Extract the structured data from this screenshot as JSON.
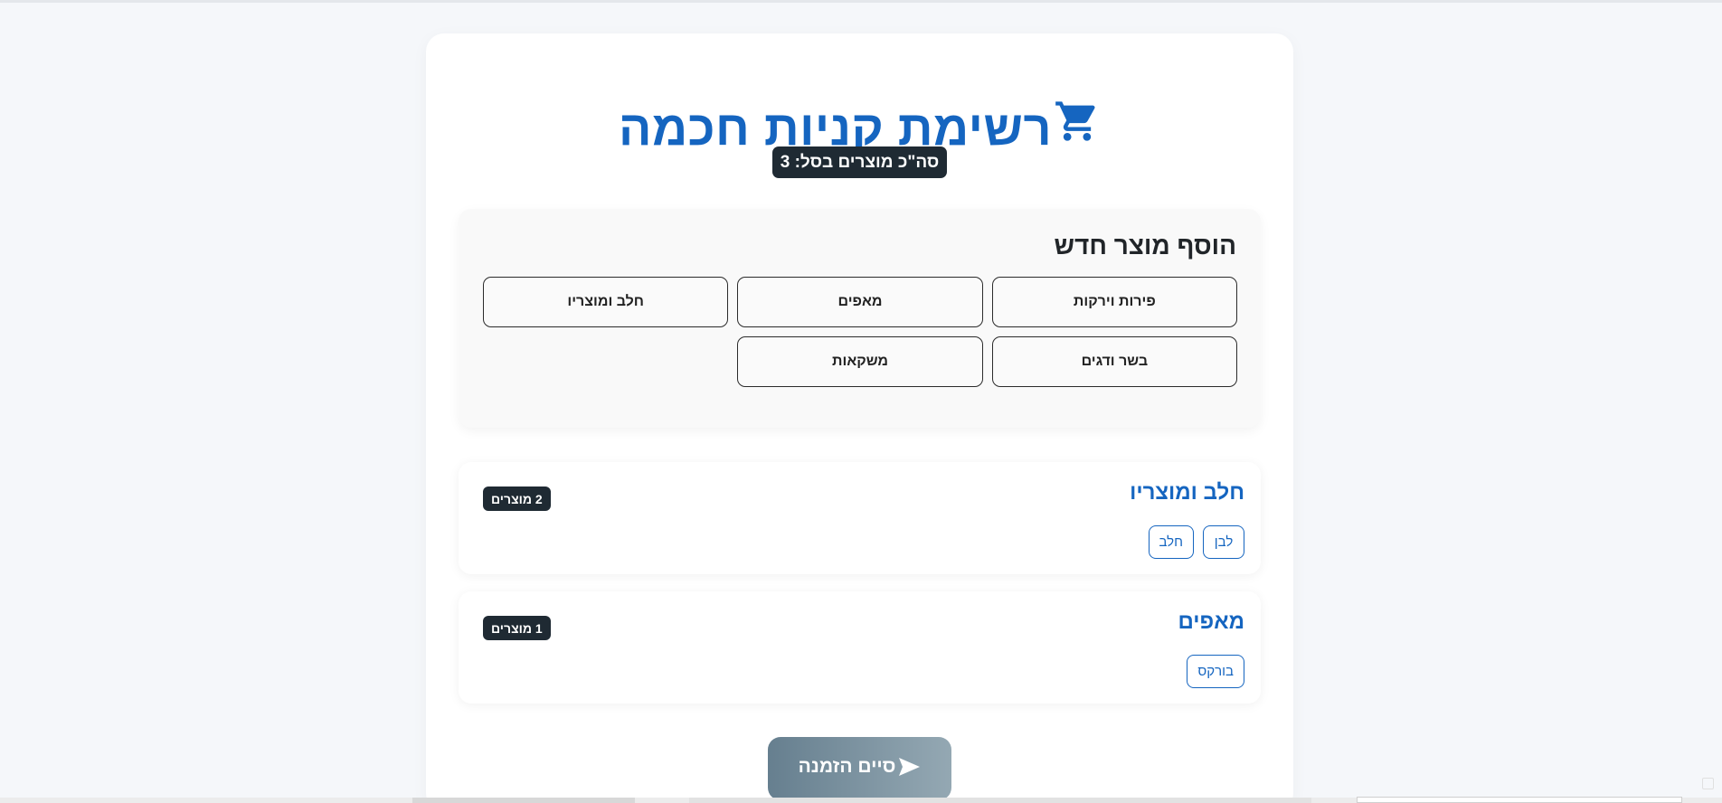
{
  "app": {
    "title": "רשימת קניות חכמה",
    "title_icon": "shopping-cart-icon",
    "total_label": "סה\"כ מוצרים בסל: 3"
  },
  "add_product": {
    "heading": "הוסף מוצר חדש",
    "categories": [
      {
        "label": "פירות וירקות"
      },
      {
        "label": "מאפים"
      },
      {
        "label": "חלב ומוצריו"
      },
      {
        "label": "בשר ודגים"
      },
      {
        "label": "משקאות"
      }
    ]
  },
  "cart_sections": [
    {
      "title": "חלב ומוצריו",
      "count_label": "2 מוצרים",
      "items": [
        "לבן",
        "חלב"
      ]
    },
    {
      "title": "מאפים",
      "count_label": "1 מוצרים",
      "items": [
        "בורקס"
      ]
    }
  ],
  "finish": {
    "label": "סיים הזמנה",
    "icon": "send-icon"
  },
  "colors": {
    "accent": "#1565c0",
    "badge_bg": "#1f2a33",
    "page_bg": "#f5f7fa",
    "finish_gradient_start": "#667f8f",
    "finish_gradient_end": "#94a8b3"
  }
}
